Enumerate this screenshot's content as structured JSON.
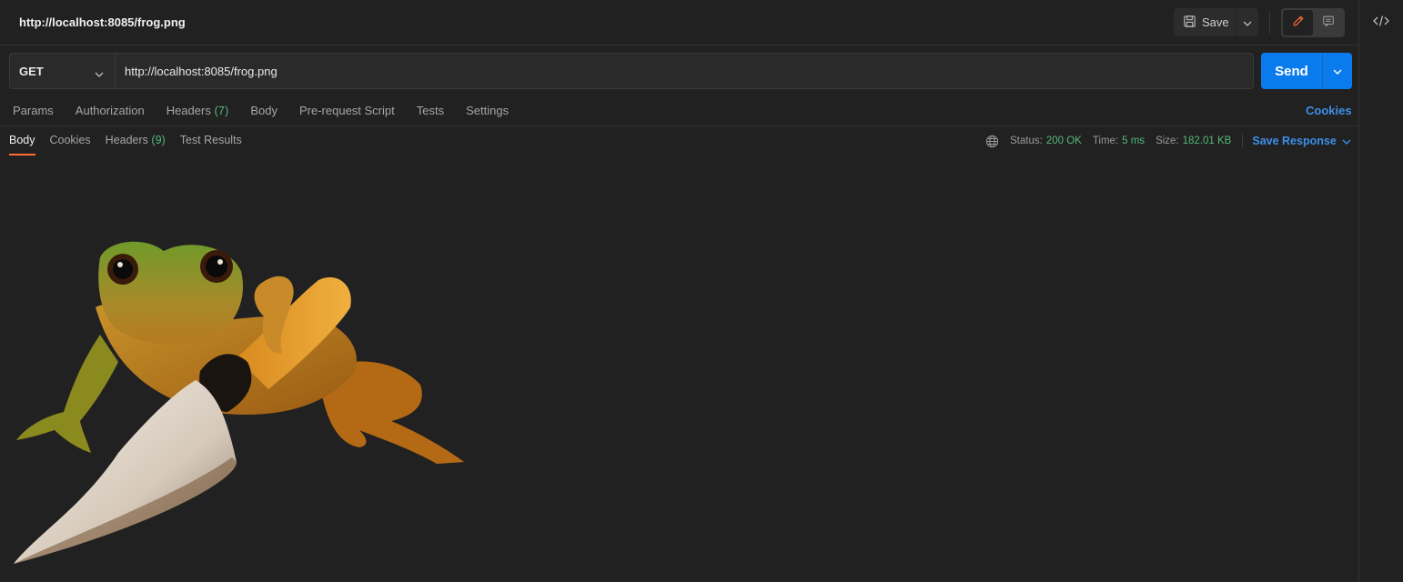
{
  "request": {
    "title": "http://localhost:8085/frog.png",
    "method": "GET",
    "url": "http://localhost:8085/frog.png"
  },
  "toolbar": {
    "save_label": "Save",
    "send_label": "Send",
    "edit_icon": "pencil-icon",
    "comment_icon": "comment-icon",
    "code_icon": "code-icon"
  },
  "request_tabs": {
    "params": "Params",
    "authorization": "Authorization",
    "headers_label": "Headers",
    "headers_count": "(7)",
    "body": "Body",
    "pre_request": "Pre-request Script",
    "tests": "Tests",
    "settings": "Settings",
    "cookies": "Cookies"
  },
  "response_tabs": {
    "body": "Body",
    "cookies": "Cookies",
    "headers_label": "Headers",
    "headers_count": "(9)",
    "test_results": "Test Results"
  },
  "response_meta": {
    "status_label": "Status:",
    "status_value": "200 OK",
    "time_label": "Time:",
    "time_value": "5 ms",
    "size_label": "Size:",
    "size_value": "182.01 KB",
    "save_response": "Save Response"
  },
  "colors": {
    "accent_blue": "#097bed",
    "link_blue": "#3d8fe9",
    "success_green": "#56b77a",
    "active_tab_orange": "#ff6c37",
    "background": "#212121"
  }
}
